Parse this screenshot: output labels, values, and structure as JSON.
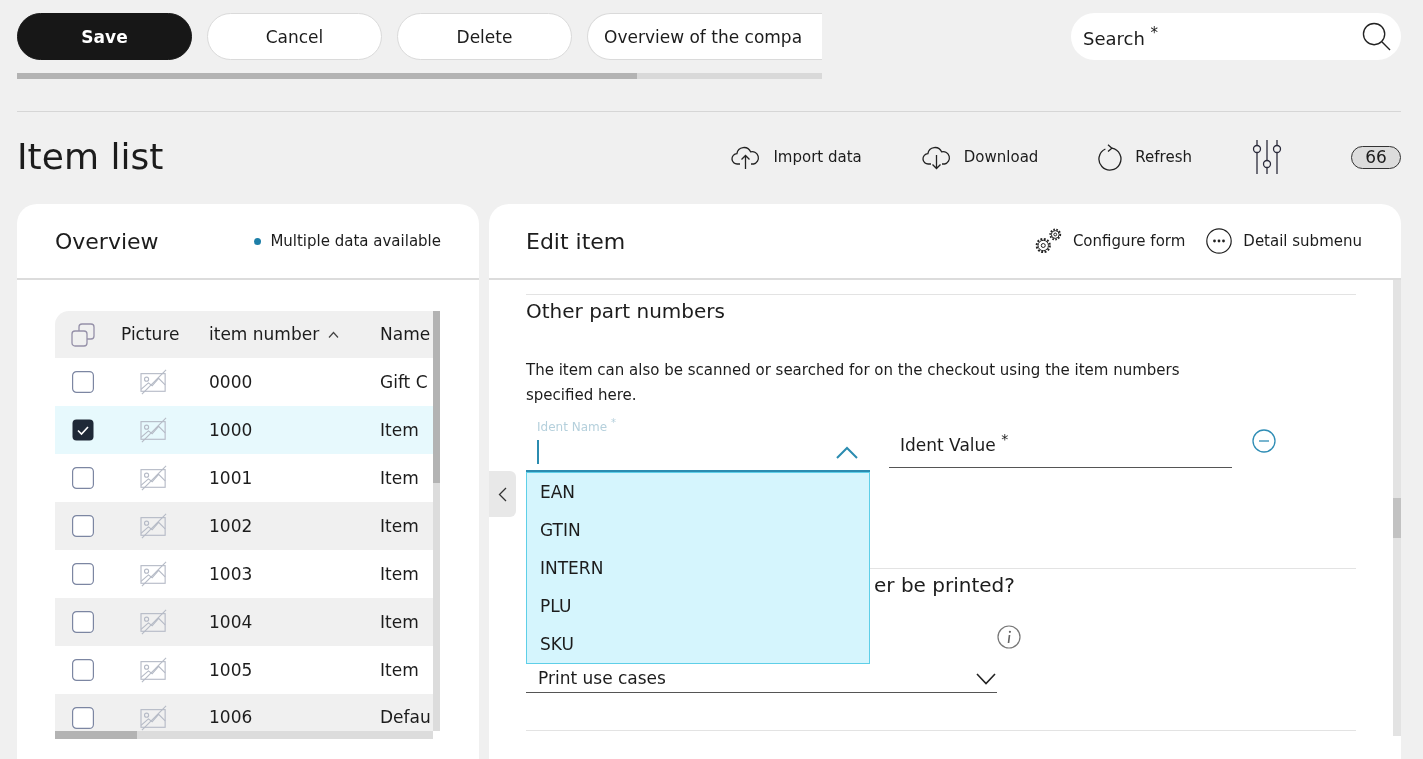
{
  "toolbar": {
    "buttons": [
      {
        "label": "Save",
        "kind": "primary"
      },
      {
        "label": "Cancel",
        "kind": "secondary"
      },
      {
        "label": "Delete",
        "kind": "secondary"
      },
      {
        "label": "Overview of the compa",
        "kind": "secondary"
      }
    ],
    "search": {
      "placeholder": "Search $^{*}$"
    }
  },
  "header": {
    "title": "Item list",
    "actions": [
      {
        "kind": "upload",
        "label": "Import data"
      },
      {
        "kind": "download",
        "label": "Download"
      },
      {
        "kind": "refresh",
        "label": "Refresh"
      },
      {
        "kind": "filters"
      }
    ],
    "count": "66"
  },
  "overview": {
    "title": "Overview",
    "status": "Multiple data available",
    "table": {
      "columns": [
        {
          "label": "Picture",
          "sorted": false
        },
        {
          "label": "item number",
          "sorted": true
        },
        {
          "label": "Name",
          "sorted": false
        }
      ],
      "rows": [
        {
          "number": "0000",
          "name": "Gift C",
          "checked": false,
          "selected": false
        },
        {
          "number": "1000",
          "name": "Item",
          "checked": true,
          "selected": true
        },
        {
          "number": "1001",
          "name": "Item",
          "checked": false,
          "selected": false
        },
        {
          "number": "1002",
          "name": "Item",
          "checked": false,
          "selected": false
        },
        {
          "number": "1003",
          "name": "Item",
          "checked": false,
          "selected": false
        },
        {
          "number": "1004",
          "name": "Item",
          "checked": false,
          "selected": false
        },
        {
          "number": "1005",
          "name": "Item",
          "checked": false,
          "selected": false
        },
        {
          "number": "1006",
          "name": "Defau",
          "checked": false,
          "selected": false
        }
      ]
    }
  },
  "editor": {
    "title": "Edit item",
    "actions": [
      {
        "kind": "configure",
        "label": "Configure form"
      },
      {
        "kind": "more",
        "label": "Detail submenu"
      }
    ],
    "section": {
      "title": "Other part numbers",
      "description": "The item can also be scanned or searched for on the checkout using the item numbers specified here.",
      "ident_name": {
        "label": "Ident Name $^{*}$",
        "focused": true,
        "expanded": true,
        "options": [
          {
            "label": "EAN",
            "selected": false
          },
          {
            "label": "GTIN",
            "selected": false
          },
          {
            "label": "INTERN",
            "selected": false
          },
          {
            "label": "PLU",
            "selected": false
          },
          {
            "label": "SKU",
            "selected": false
          }
        ]
      },
      "ident_value": {
        "placeholder": "Ident Value $^{*}$"
      }
    },
    "print_section": {
      "title": "er be printed?",
      "select": {
        "value": "Print use cases",
        "expanded": false
      }
    }
  }
}
